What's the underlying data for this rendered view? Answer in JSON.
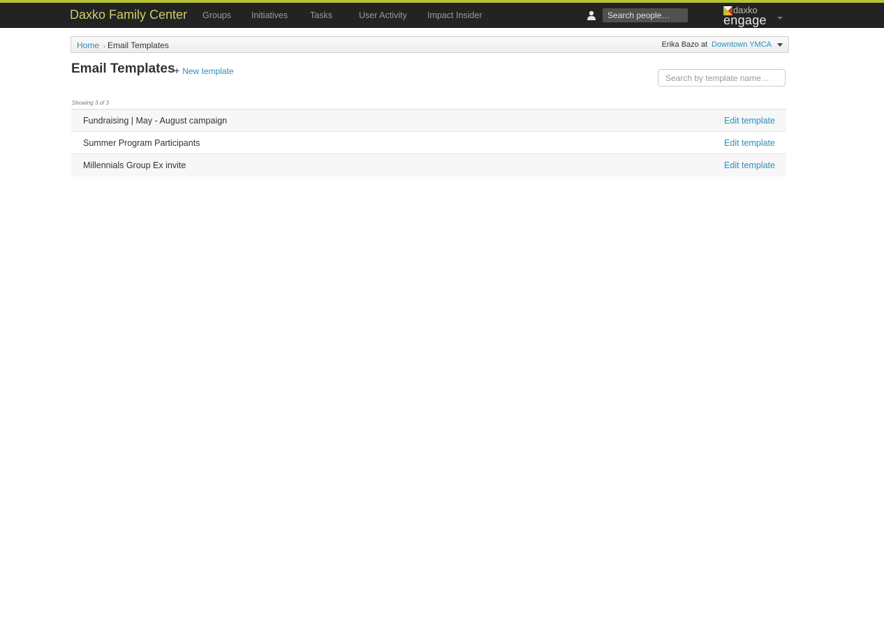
{
  "colors": {
    "accent": "#b5c334",
    "navbar": "#232323",
    "brand": "#c7cf6a",
    "link": "#2a8fbd"
  },
  "navbar": {
    "brand": "Daxko Family Center",
    "items": [
      {
        "label": "Groups"
      },
      {
        "label": "Initiatives"
      },
      {
        "label": "Tasks"
      },
      {
        "label": "User Activity"
      },
      {
        "label": "Impact Insider"
      }
    ],
    "people_search": {
      "placeholder": "Search people…",
      "icon": "user-icon"
    },
    "logo": {
      "top": "daxko",
      "bottom": "engage"
    }
  },
  "breadcrumb": {
    "home": "Home",
    "separator": "›",
    "current": "Email Templates"
  },
  "user_location": {
    "user": "Erika Bazo at",
    "location": "Downtown YMCA"
  },
  "page": {
    "title": "Email Templates",
    "new_template": "New template",
    "search_placeholder": "Search by template name…",
    "showing": "Showing 3 of 3"
  },
  "templates": [
    {
      "name": "Fundraising | May - August campaign",
      "action": "Edit template"
    },
    {
      "name": "Summer Program Participants",
      "action": "Edit template"
    },
    {
      "name": "Millennials Group Ex invite",
      "action": "Edit template"
    }
  ]
}
